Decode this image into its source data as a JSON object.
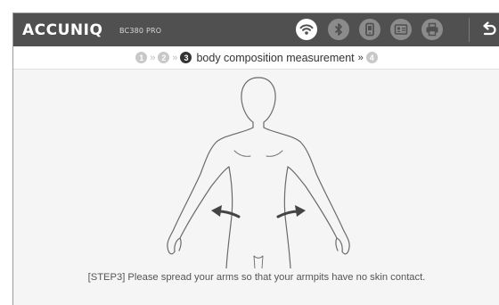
{
  "header": {
    "brand": "ACCUNIQ",
    "model": "BC380 PRO",
    "icons": [
      {
        "name": "wifi-icon",
        "state": "active"
      },
      {
        "name": "bluetooth-icon",
        "state": "inactive"
      },
      {
        "name": "phone-icon",
        "state": "inactive"
      },
      {
        "name": "id-card-icon",
        "state": "inactive"
      },
      {
        "name": "printer-icon",
        "state": "inactive"
      }
    ],
    "back_icon": "back-arrow-icon"
  },
  "steps": {
    "items": [
      {
        "number": "1",
        "active": false
      },
      {
        "number": "2",
        "active": false
      },
      {
        "number": "3",
        "active": true
      },
      {
        "number": "4",
        "active": false
      }
    ],
    "separator": "»",
    "current_label": "body composition measurement"
  },
  "illustration": {
    "name": "body-outline-arms-spread",
    "arrows": [
      "left-outward-arrow",
      "right-outward-arrow"
    ]
  },
  "instruction": "[STEP3] Please spread your arms so that your armpits have no skin contact.",
  "colors": {
    "topbar": "#505050",
    "active_icon": "#ffffff",
    "inactive_icon": "#8b8b8b",
    "step_active": "#333333",
    "step_inactive": "#c8c8c8"
  }
}
